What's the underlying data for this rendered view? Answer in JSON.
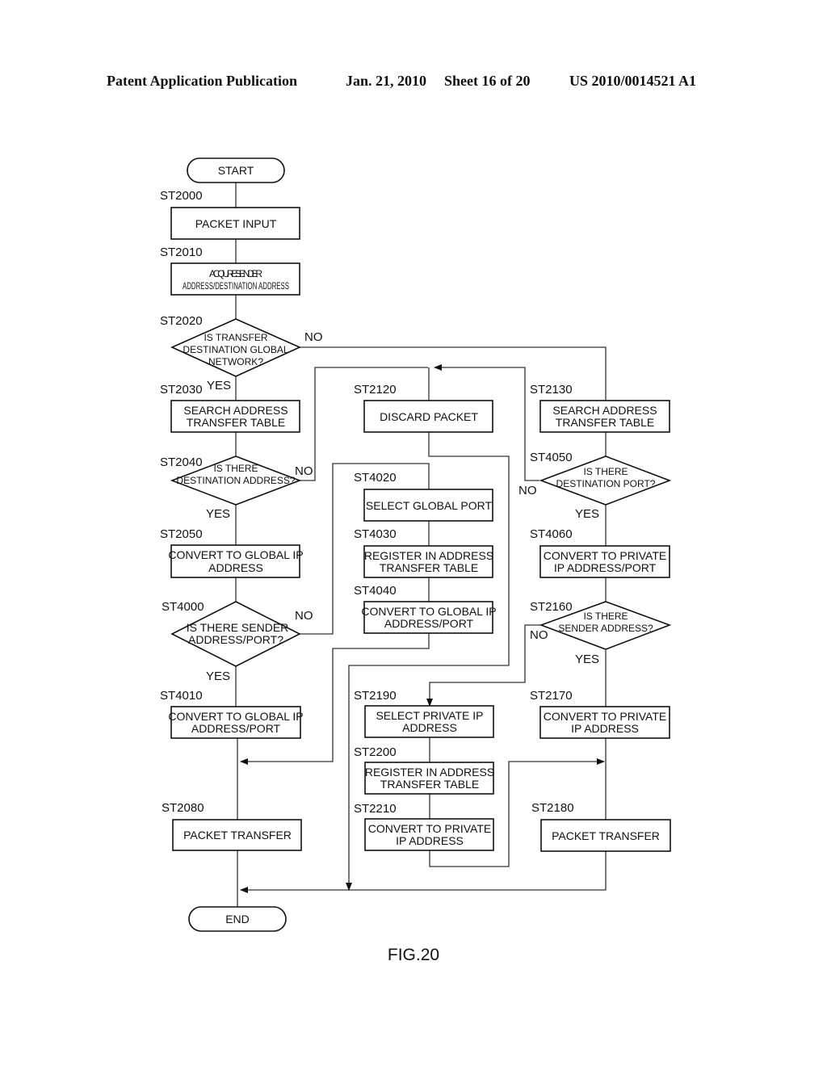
{
  "header": {
    "publication": "Patent Application Publication",
    "date": "Jan. 21, 2010",
    "sheet": "Sheet 16 of 20",
    "number": "US 2010/0014521 A1"
  },
  "figure_label": "FIG.20",
  "terminals": {
    "start": "START",
    "end": "END"
  },
  "steps": {
    "st2000": {
      "id": "ST2000",
      "line1": "PACKET INPUT",
      "line2": ""
    },
    "st2010": {
      "id": "ST2010",
      "line1": "ACQUIRE SENDER",
      "line2": "ADDRESS/DESTINATION ADDRESS"
    },
    "st2030": {
      "id": "ST2030",
      "line1": "SEARCH ADDRESS",
      "line2": "TRANSFER TABLE"
    },
    "st2050": {
      "id": "ST2050",
      "line1": "CONVERT TO GLOBAL IP",
      "line2": "ADDRESS"
    },
    "st4010": {
      "id": "ST4010",
      "line1": "CONVERT TO GLOBAL IP",
      "line2": "ADDRESS/PORT"
    },
    "st2080": {
      "id": "ST2080",
      "line1": "PACKET TRANSFER",
      "line2": ""
    },
    "st2120": {
      "id": "ST2120",
      "line1": "DISCARD PACKET",
      "line2": ""
    },
    "st4020": {
      "id": "ST4020",
      "line1": "SELECT GLOBAL PORT",
      "line2": ""
    },
    "st4030": {
      "id": "ST4030",
      "line1": "REGISTER IN ADDRESS",
      "line2": "TRANSFER TABLE"
    },
    "st4040": {
      "id": "ST4040",
      "line1": "CONVERT TO GLOBAL IP",
      "line2": "ADDRESS/PORT"
    },
    "st2190": {
      "id": "ST2190",
      "line1": "SELECT PRIVATE IP",
      "line2": "ADDRESS"
    },
    "st2200": {
      "id": "ST2200",
      "line1": "REGISTER IN ADDRESS",
      "line2": "TRANSFER TABLE"
    },
    "st2210": {
      "id": "ST2210",
      "line1": "CONVERT TO PRIVATE",
      "line2": "IP ADDRESS"
    },
    "st2130": {
      "id": "ST2130",
      "line1": "SEARCH ADDRESS",
      "line2": "TRANSFER TABLE"
    },
    "st4060": {
      "id": "ST4060",
      "line1": "CONVERT TO PRIVATE",
      "line2": "IP ADDRESS/PORT"
    },
    "st2170": {
      "id": "ST2170",
      "line1": "CONVERT TO PRIVATE",
      "line2": "IP ADDRESS"
    },
    "st2180": {
      "id": "ST2180",
      "line1": "PACKET TRANSFER",
      "line2": ""
    }
  },
  "decisions": {
    "st2020": {
      "id": "ST2020",
      "line1": "IS TRANSFER",
      "line2": "DESTINATION GLOBAL",
      "line3": "NETWORK?",
      "yes": "YES",
      "no": "NO"
    },
    "st2040": {
      "id": "ST2040",
      "line1": "IS THERE",
      "line2": "DESTINATION ADDRESS?",
      "yes": "YES",
      "no": "NO"
    },
    "st4000": {
      "id": "ST4000",
      "line1": "IS THERE SENDER",
      "line2": "ADDRESS/PORT?",
      "yes": "YES",
      "no": "NO"
    },
    "st4050": {
      "id": "ST4050",
      "line1": "IS THERE",
      "line2": "DESTINATION PORT?",
      "yes": "YES",
      "no": "NO"
    },
    "st2160": {
      "id": "ST2160",
      "line1": "IS THERE",
      "line2": "SENDER ADDRESS?",
      "yes": "YES",
      "no": "NO"
    }
  }
}
